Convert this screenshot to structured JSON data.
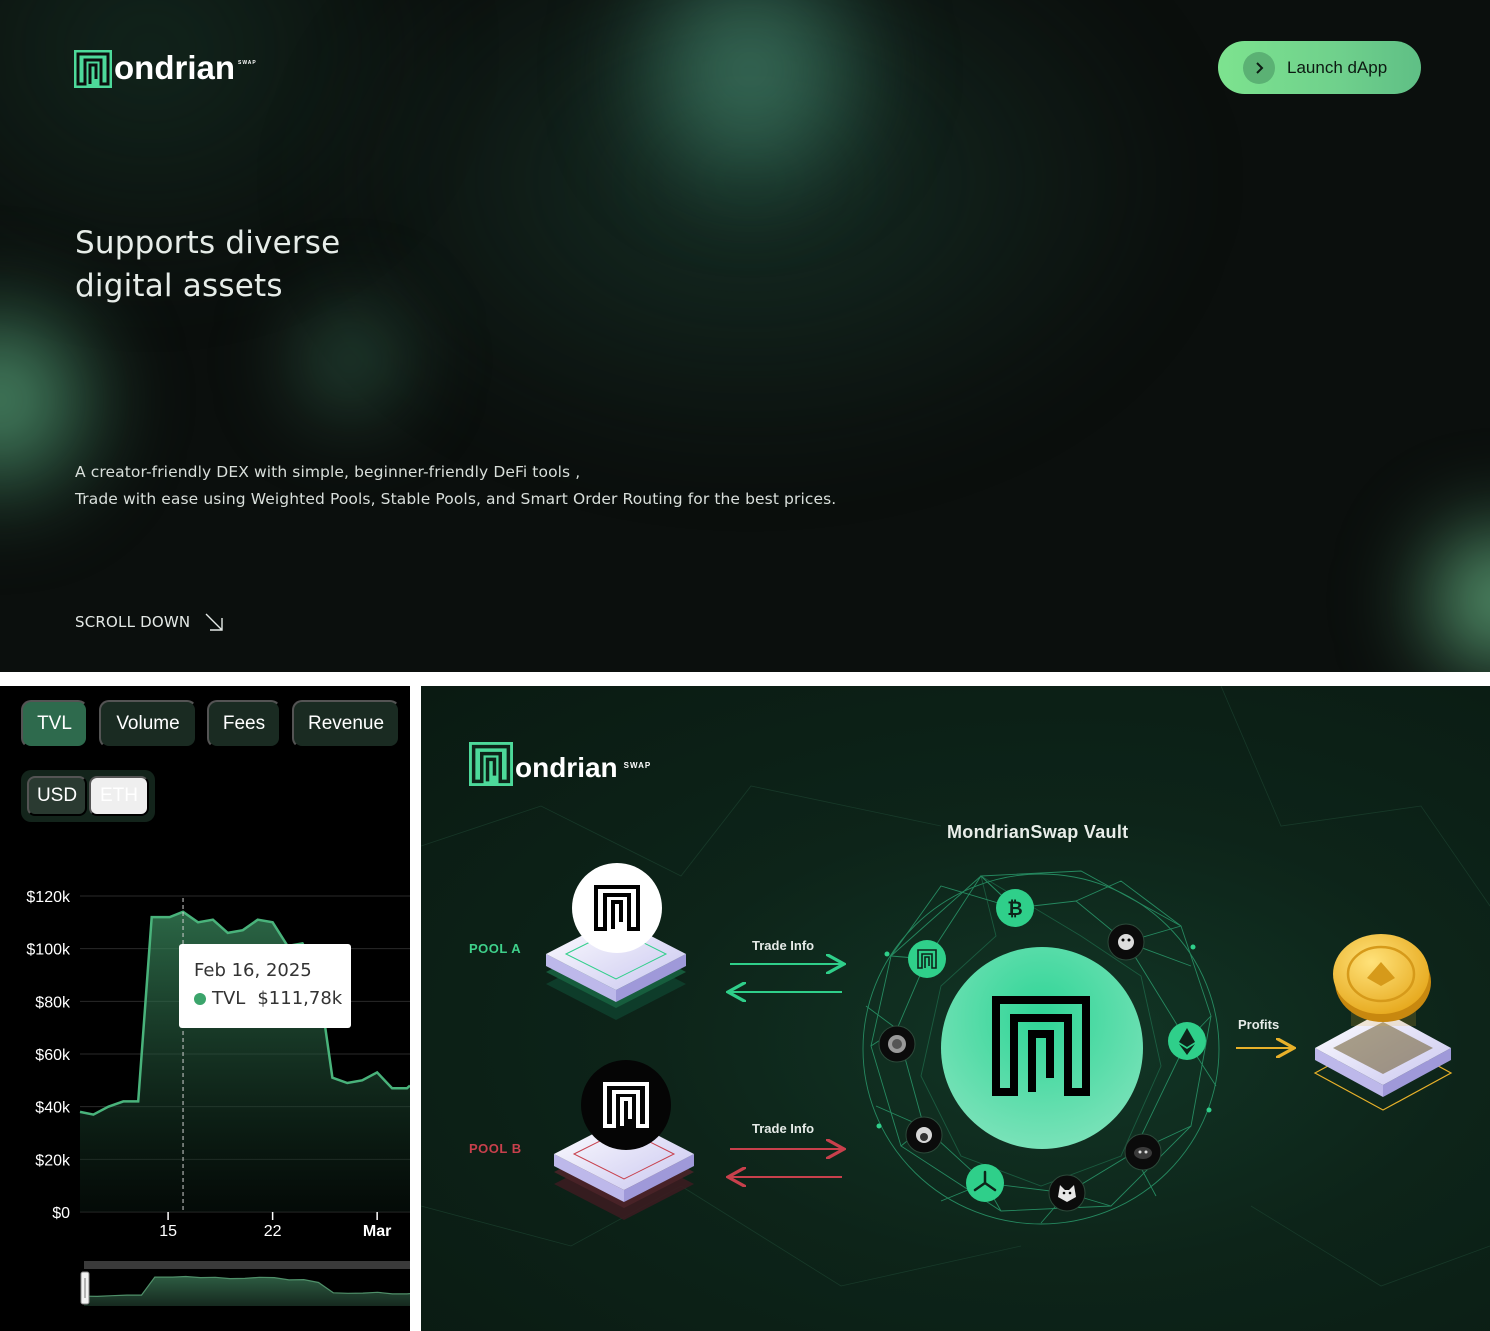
{
  "hero": {
    "brand": "ondrian",
    "brand_sup": "SWAP",
    "launch_button": "Launch dApp",
    "title_line1": "Supports diverse",
    "title_line2": "digital assets",
    "description_line1": "A creator-friendly DEX with simple, beginner-friendly DeFi tools ,",
    "description_line2": "Trade with ease using Weighted Pools, Stable Pools, and Smart Order Routing for the best prices.",
    "scroll_down": "SCROLL DOWN"
  },
  "dashboard": {
    "metric_tabs": [
      {
        "label": "TVL",
        "active": true
      },
      {
        "label": "Volume",
        "active": false
      },
      {
        "label": "Fees",
        "active": false
      },
      {
        "label": "Revenue",
        "active": false
      }
    ],
    "currency": [
      {
        "label": "USD",
        "active": true
      },
      {
        "label": "ETH",
        "active": false
      }
    ],
    "tooltip": {
      "date": "Feb 16, 2025",
      "series": "TVL",
      "value": "$111,78k"
    }
  },
  "chart_data": {
    "type": "area",
    "title": "",
    "xlabel": "",
    "ylabel": "",
    "y_ticks": [
      "$120k",
      "$100k",
      "$80k",
      "$60k",
      "$40k",
      "$20k",
      "$0"
    ],
    "y_tick_values": [
      120000,
      100000,
      80000,
      60000,
      40000,
      20000,
      0
    ],
    "x_ticks": [
      "15",
      "22",
      "Mar"
    ],
    "x_tick_positions": [
      15,
      22,
      29
    ],
    "ylim": [
      0,
      120000
    ],
    "xlim": [
      9.1,
      31.2
    ],
    "grid": "horizontal",
    "color": "#49b37b",
    "series": [
      {
        "x": [
          9.1,
          10,
          11,
          12,
          13,
          13.9,
          14.5,
          15.1,
          16,
          17,
          18,
          19,
          20,
          21,
          22,
          23,
          24,
          25,
          26,
          27,
          28,
          29,
          30,
          31,
          31.2
        ],
        "values": [
          38000,
          37000,
          40000,
          42000,
          42000,
          112000,
          112000,
          112000,
          114000,
          110000,
          111000,
          106000,
          107000,
          111000,
          110000,
          101000,
          102000,
          91000,
          51000,
          49000,
          50000,
          53000,
          47000,
          47000,
          48000
        ]
      }
    ],
    "highlight": {
      "x": 16,
      "label": "Feb 16, 2025",
      "value": 111780
    }
  },
  "vault": {
    "brand": "ondrian",
    "brand_sup": "SWAP",
    "title": "MondrianSwap Vault",
    "pool_a": "POOL A",
    "pool_b": "POOL B",
    "trade_info_a": "Trade Info",
    "trade_info_b": "Trade Info",
    "profits": "Profits",
    "colors": {
      "pool_a": "#3fd18b",
      "pool_b": "#c8404c",
      "profits": "#e8b12a",
      "vault": "#38d596"
    },
    "orbit_icons": [
      "bitcoin-icon",
      "mondrian-token-icon",
      "ethereum-icon",
      "penguin-icon",
      "seal-icon",
      "gorilla-icon",
      "ghost-icon",
      "fan-icon",
      "shiba-icon",
      "dark-token-icon"
    ]
  }
}
